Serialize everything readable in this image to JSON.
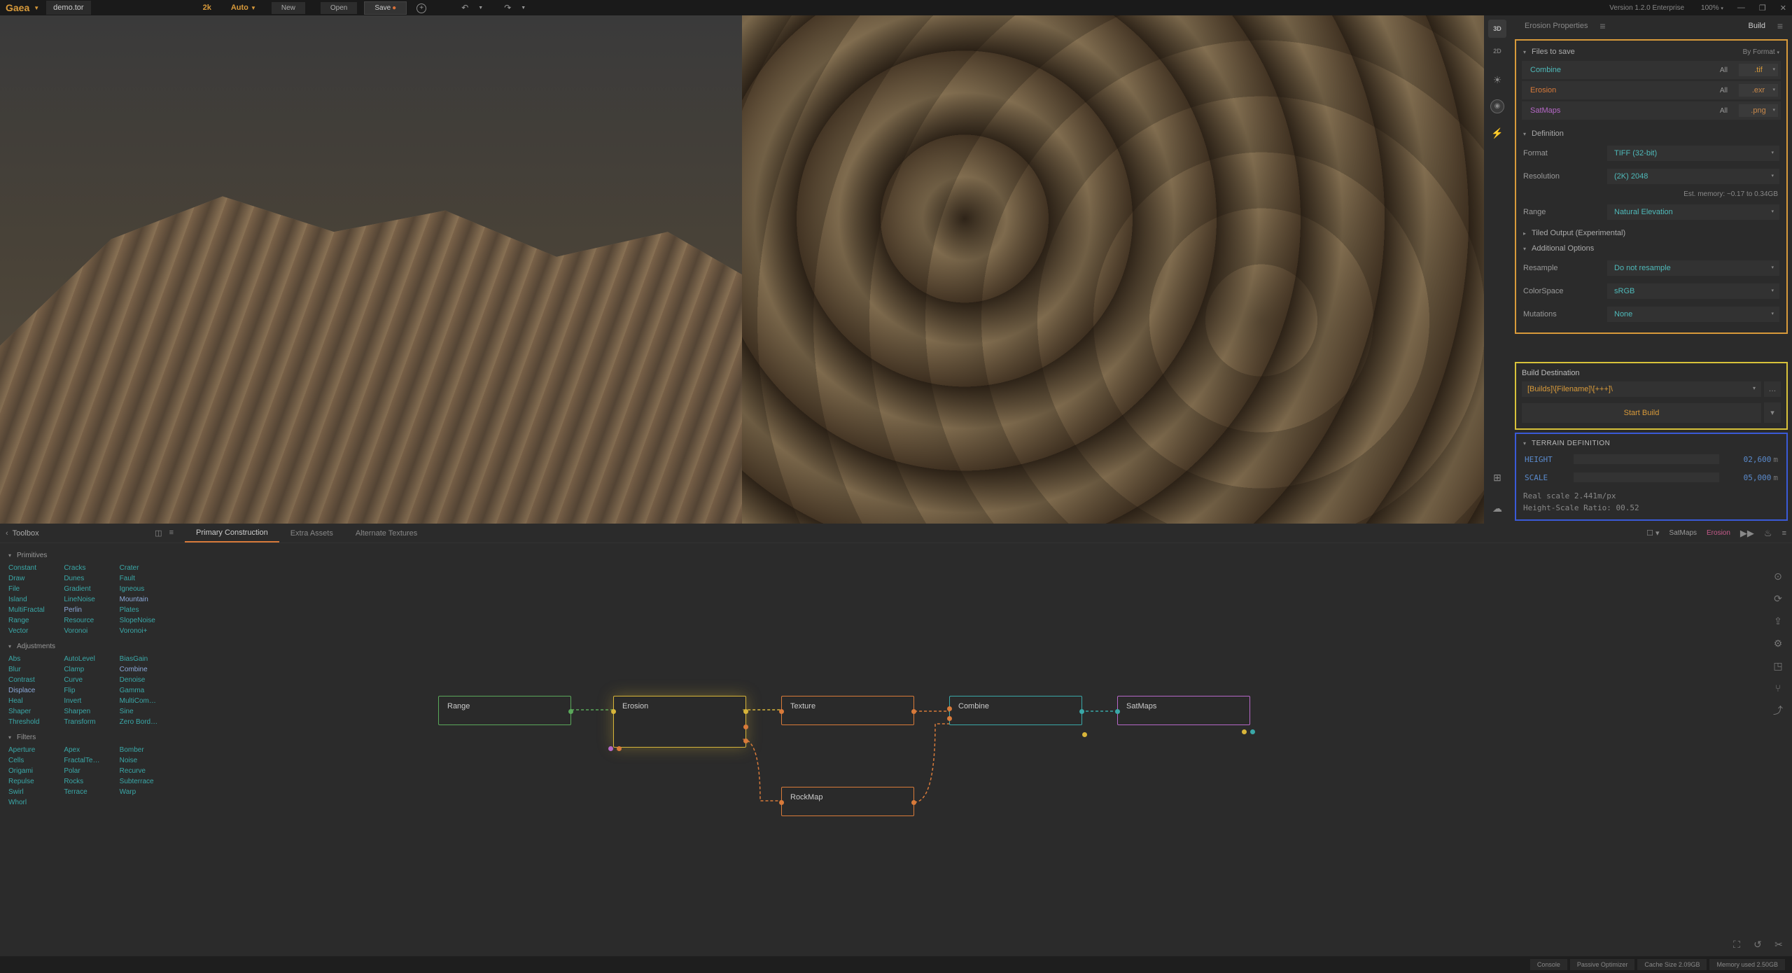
{
  "topbar": {
    "brand": "Gaea",
    "filename": "demo.tor",
    "resolution": "2k",
    "mode": "Auto",
    "new_label": "New",
    "open_label": "Open",
    "save_label": "Save",
    "version": "Version 1.2.0 Enterprise",
    "zoom": "100%"
  },
  "viewport": {
    "view3d": "3D",
    "view2d": "2D"
  },
  "rightPanel": {
    "tab_erosion": "Erosion Properties",
    "tab_build": "Build",
    "files_to_save": "Files to save",
    "by_format": "By Format",
    "files": [
      {
        "name": "Combine",
        "all": "All",
        "ext": ".tif",
        "colorClass": "c-combine",
        "extClass": "c-tif"
      },
      {
        "name": "Erosion",
        "all": "All",
        "ext": ".exr",
        "colorClass": "c-erosion",
        "extClass": "c-exr"
      },
      {
        "name": "SatMaps",
        "all": "All",
        "ext": ".png",
        "colorClass": "c-satmaps",
        "extClass": "c-png"
      }
    ],
    "definition": "Definition",
    "def_format": "Format",
    "def_format_v": "TIFF (32-bit)",
    "def_res": "Resolution",
    "def_res_v": "(2K) 2048",
    "est_memory": "Est. memory: ~0.17 to 0.34GB",
    "def_range": "Range",
    "def_range_v": "Natural Elevation",
    "tiled": "Tiled Output (Experimental)",
    "additional": "Additional Options",
    "resample": "Resample",
    "resample_v": "Do not resample",
    "colorspace": "ColorSpace",
    "colorspace_v": "sRGB",
    "mutations": "Mutations",
    "mutations_v": "None",
    "build_dest": "Build Destination",
    "build_path": "[Builds]\\[Filename]\\[+++]\\",
    "start_build": "Start Build",
    "terrain_def": "TERRAIN DEFINITION",
    "height": "HEIGHT",
    "height_v": "02,600",
    "scale": "SCALE",
    "scale_v": "05,000",
    "unit": "m",
    "real_scale": "Real scale 2.441m/px",
    "ratio": "Height-Scale Ratio: 00.52"
  },
  "toolbox": {
    "title": "Toolbox",
    "sections": {
      "primitives": {
        "label": "Primitives",
        "items": [
          "Constant",
          "Cracks",
          "Crater",
          "Draw",
          "Dunes",
          "Fault",
          "File",
          "Gradient",
          "Igneous",
          "Island",
          "LineNoise",
          "Mountain",
          "MultiFractal",
          "Perlin",
          "Plates",
          "Range",
          "Resource",
          "SlopeNoise",
          "Vector",
          "Voronoi",
          "Voronoi+"
        ]
      },
      "adjustments": {
        "label": "Adjustments",
        "items": [
          "Abs",
          "AutoLevel",
          "BiasGain",
          "Blur",
          "Clamp",
          "Combine",
          "Contrast",
          "Curve",
          "Denoise",
          "Displace",
          "Flip",
          "Gamma",
          "Heal",
          "Invert",
          "MultiCom…",
          "Shaper",
          "Sharpen",
          "Sine",
          "Threshold",
          "Transform",
          "Zero Bord…"
        ]
      },
      "filters": {
        "label": "Filters",
        "items": [
          "Aperture",
          "Apex",
          "Bomber",
          "Cells",
          "FractalTe…",
          "Noise",
          "Origami",
          "Polar",
          "Recurve",
          "Repulse",
          "Rocks",
          "Subterrace",
          "Swirl",
          "Terrace",
          "Warp",
          "Whorl"
        ]
      }
    }
  },
  "graph": {
    "tab_primary": "Primary Construction",
    "tab_extra": "Extra Assets",
    "tab_alt": "Alternate Textures",
    "label_satmaps": "SatMaps",
    "label_erosion": "Erosion",
    "nodes": {
      "range": "Range",
      "erosion": "Erosion",
      "texture": "Texture",
      "rockmap": "RockMap",
      "combine": "Combine",
      "satmaps": "SatMaps"
    }
  },
  "status": {
    "console": "Console",
    "passive": "Passive Optimizer",
    "cache": "Cache Size 2.09GB",
    "memory": "Memory used 2.50GB"
  }
}
